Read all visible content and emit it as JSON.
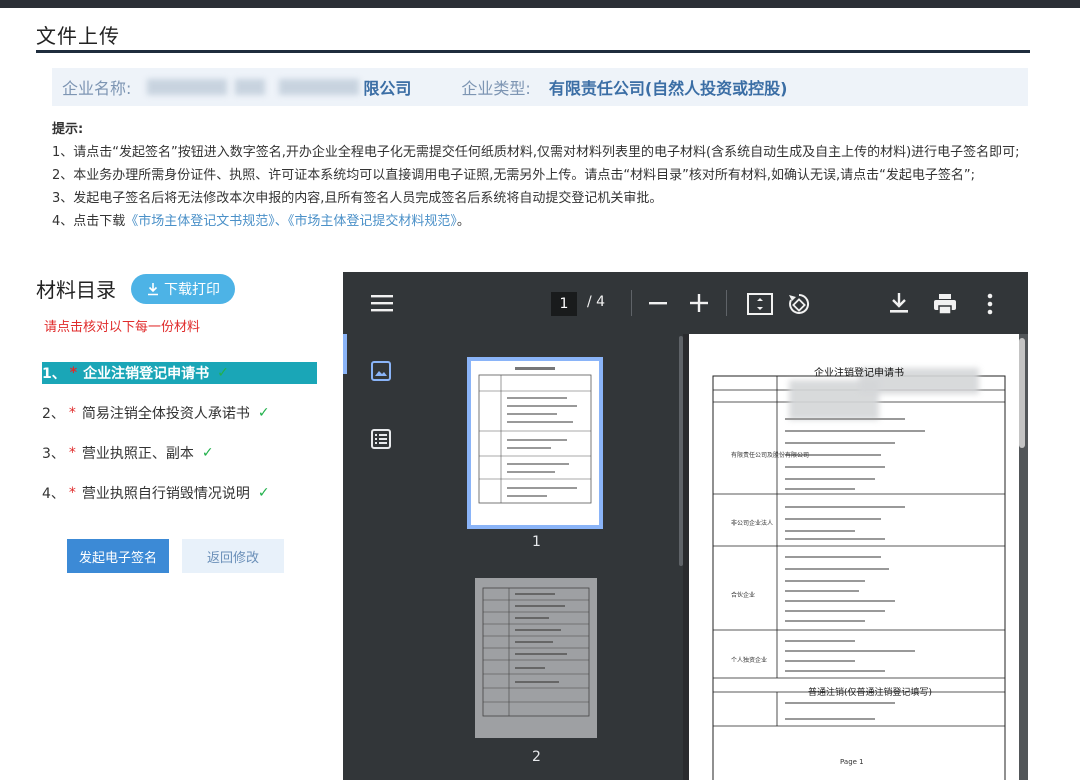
{
  "page": {
    "title": "文件上传"
  },
  "company": {
    "name_label": "企业名称:",
    "name_suffix": "限公司",
    "type_label": "企业类型:",
    "type_value": "有限责任公司(自然人投资或控股)"
  },
  "tips": {
    "title": "提示:",
    "line1": "1、请点击“发起签名”按钮进入数字签名,开办企业全程电子化无需提交任何纸质材料,仅需对材料列表里的电子材料(含系统自动生成及自主上传的材料)进行电子签名即可;",
    "line2": "2、本业务办理所需身份证件、执照、许可证本系统均可以直接调用电子证照,无需另外上传。请点击“材料目录”核对所有材料,如确认无误,请点击“发起电子签名”;",
    "line3": "3、发起电子签名后将无法修改本次申报的内容,且所有签名人员完成签名后系统将自动提交登记机关审批。",
    "line4_prefix": "4、点击下载",
    "link1": "《市场主体登记文书规范》",
    "sep": "、",
    "link2": "《市场主体登记提交材料规范》",
    "line4_suffix": "。"
  },
  "materials": {
    "title": "材料目录",
    "download_label": "下载打印",
    "hint": "请点击核对以下每一份材料",
    "items": [
      {
        "num": "1、",
        "label": "企业注销登记申请书"
      },
      {
        "num": "2、",
        "label": "简易注销全体投资人承诺书"
      },
      {
        "num": "3、",
        "label": "营业执照正、副本"
      },
      {
        "num": "4、",
        "label": "营业执照自行销毁情况说明"
      }
    ],
    "sign_button": "发起电子签名",
    "back_button": "返回修改"
  },
  "viewer": {
    "current_page": "1",
    "total_pages": "/ 4",
    "thumb_labels": [
      "1",
      "2"
    ],
    "doc_title": "企业注销登记申请书",
    "doc_footer": "Page 1",
    "section_title": "普通注销(仅普通注销登记填写)",
    "rows": [
      "有限责任公司及股份有限公司",
      "非公司企业法人",
      "合伙企业",
      "个人独资企业"
    ]
  },
  "colors": {
    "accent": "#1aa6b7",
    "sign_button": "#3c8ad6",
    "viewer_bg": "#323639",
    "warning": "#e02b2b"
  }
}
